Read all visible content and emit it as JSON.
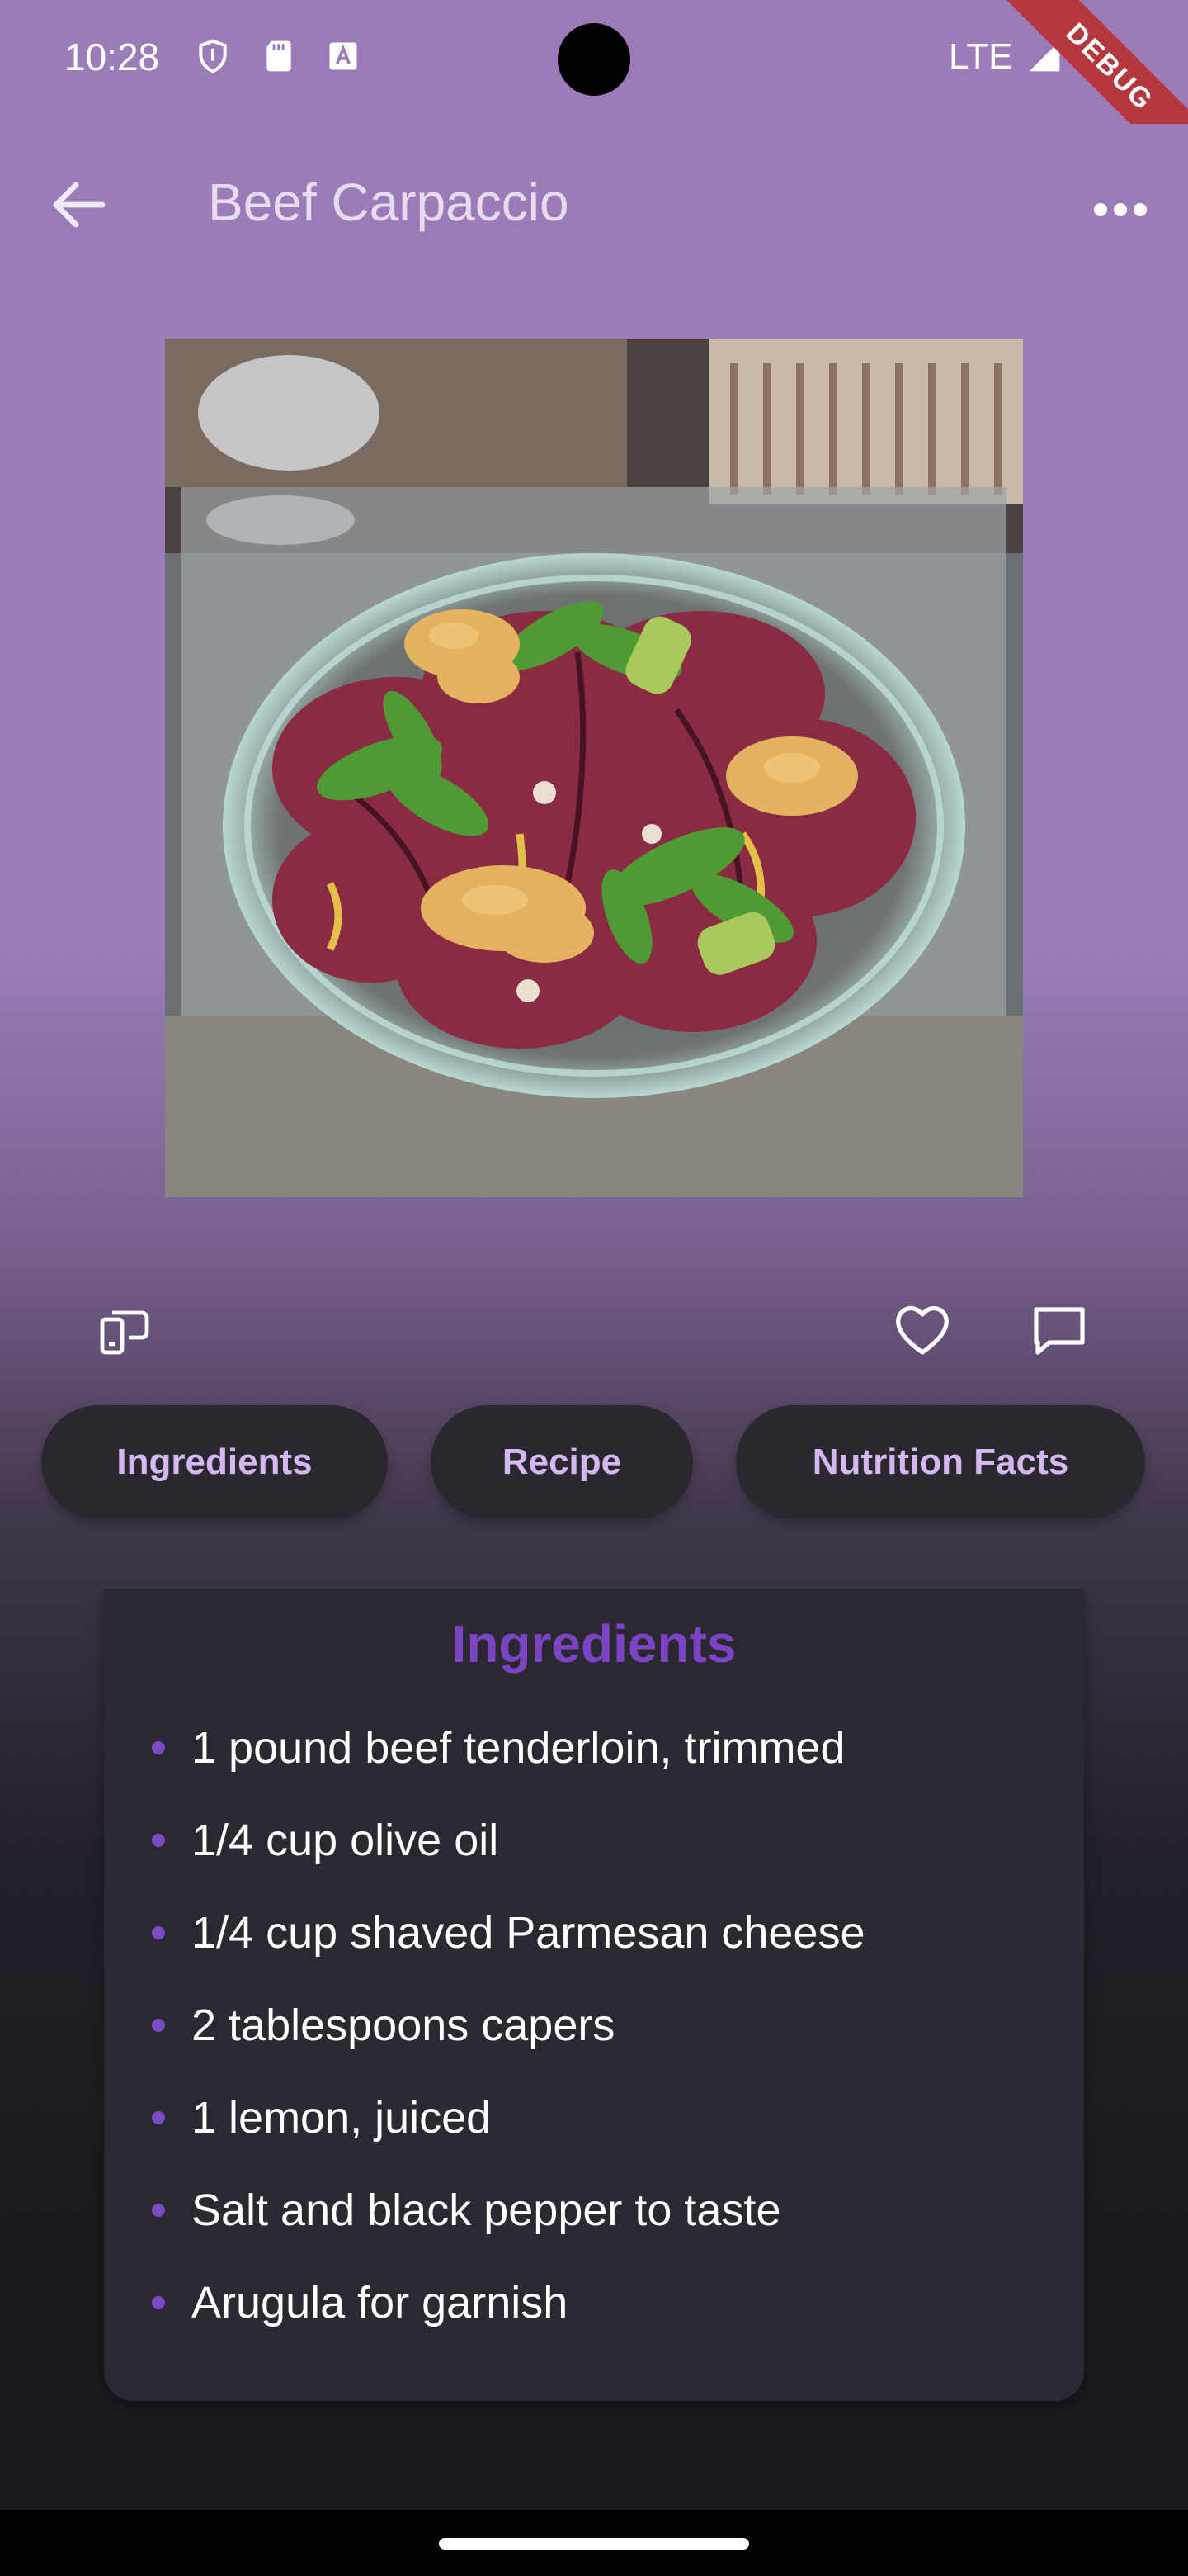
{
  "status_bar": {
    "time": "10:28",
    "network": "LTE",
    "debug_label": "DEBUG"
  },
  "app_bar": {
    "title": "Beef Carpaccio",
    "back_icon": "arrow-left-icon",
    "more_icon": "more-horiz-icon"
  },
  "hero_image": {
    "alt": "Beef carpaccio plated with arugula, fried shrimp and sauce drizzle"
  },
  "actions": {
    "left_icon": "cook-mode-icon",
    "favorite_icon": "heart-outline-icon",
    "comment_icon": "chat-bubble-icon"
  },
  "tabs": [
    {
      "label": "Ingredients"
    },
    {
      "label": "Recipe"
    },
    {
      "label": "Nutrition Facts"
    }
  ],
  "ingredients_card": {
    "title": "Ingredients",
    "items": [
      "1 pound beef tenderloin, trimmed",
      "1/4 cup olive oil",
      "1/4 cup shaved Parmesan cheese",
      "2 tablespoons capers",
      "1 lemon, juiced",
      "Salt and black pepper to taste",
      "Arugula for garnish"
    ]
  },
  "colors": {
    "app_bar": "#9b7cb8",
    "title_text": "#e6dcef",
    "pill_bg": "#2a272e",
    "pill_text": "#d3b8f2",
    "card_bg": "#2c2832",
    "card_title": "#7a44c4",
    "bullet": "#7d4ac6",
    "debug_ribbon": "#b5383e"
  }
}
